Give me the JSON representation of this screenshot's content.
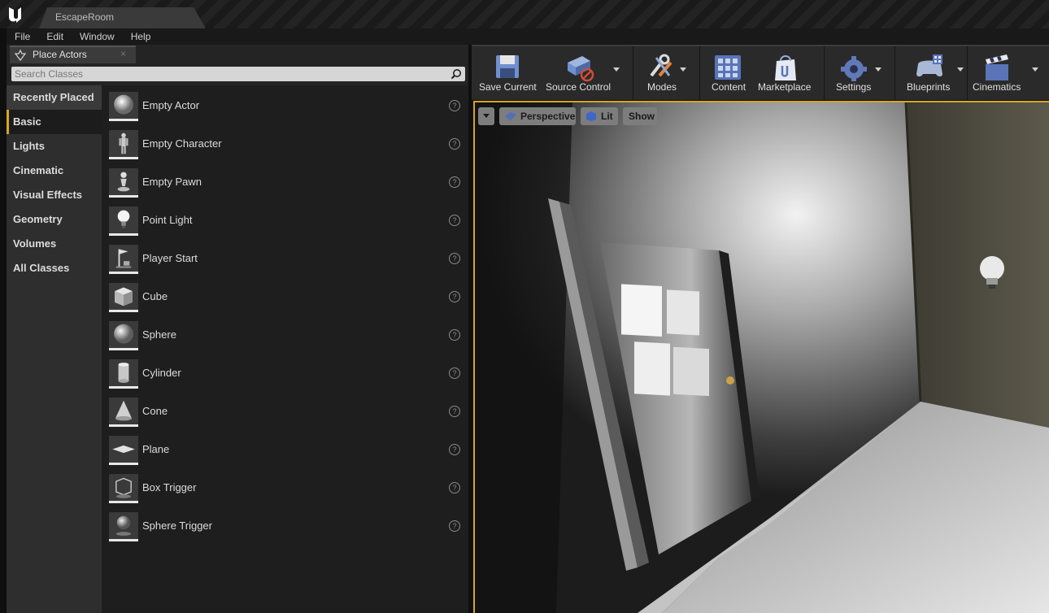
{
  "window": {
    "tab_title": "EscapeRoom"
  },
  "menu": [
    "File",
    "Edit",
    "Window",
    "Help"
  ],
  "panel": {
    "title": "Place Actors",
    "close": "×",
    "search_placeholder": "Search Classes",
    "categories": [
      "Recently Placed",
      "Basic",
      "Lights",
      "Cinematic",
      "Visual Effects",
      "Geometry",
      "Volumes",
      "All Classes"
    ],
    "active_category": "Basic",
    "actors": [
      {
        "label": "Empty Actor",
        "icon": "empty-actor-icon"
      },
      {
        "label": "Empty Character",
        "icon": "character-icon"
      },
      {
        "label": "Empty Pawn",
        "icon": "pawn-icon"
      },
      {
        "label": "Point Light",
        "icon": "light-bulb-icon"
      },
      {
        "label": "Player Start",
        "icon": "player-start-icon"
      },
      {
        "label": "Cube",
        "icon": "cube-icon"
      },
      {
        "label": "Sphere",
        "icon": "sphere-icon"
      },
      {
        "label": "Cylinder",
        "icon": "cylinder-icon"
      },
      {
        "label": "Cone",
        "icon": "cone-icon"
      },
      {
        "label": "Plane",
        "icon": "plane-icon"
      },
      {
        "label": "Box Trigger",
        "icon": "box-trigger-icon"
      },
      {
        "label": "Sphere Trigger",
        "icon": "sphere-trigger-icon"
      }
    ],
    "help_glyph": "?"
  },
  "toolbar": {
    "buttons": [
      {
        "label": "Save Current",
        "icon": "save-icon"
      },
      {
        "label": "Source Control",
        "icon": "source-control-icon"
      },
      {
        "label": "Modes",
        "icon": "modes-icon"
      },
      {
        "label": "Content",
        "icon": "content-icon"
      },
      {
        "label": "Marketplace",
        "icon": "marketplace-icon"
      },
      {
        "label": "Settings",
        "icon": "settings-icon"
      },
      {
        "label": "Blueprints",
        "icon": "blueprints-icon"
      },
      {
        "label": "Cinematics",
        "icon": "cinematics-icon"
      }
    ]
  },
  "viewport": {
    "perspective": "Perspective",
    "lit": "Lit",
    "show": "Show"
  },
  "colors": {
    "accent": "#d9a520",
    "panel_bg": "#242424",
    "viewport_border": "#d9a520"
  }
}
